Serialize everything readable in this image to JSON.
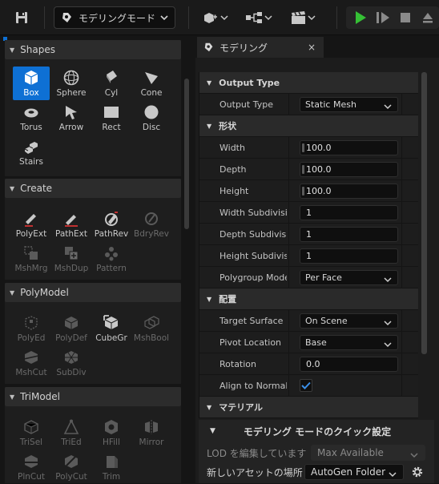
{
  "toolbar": {
    "save_icon": "save-icon",
    "mode_label": "モデリングモード"
  },
  "left_panel": {
    "sections": [
      {
        "title": "Shapes",
        "tools": [
          {
            "label": "Box",
            "icon": "box-icon",
            "selected": true
          },
          {
            "label": "Sphere",
            "icon": "sphere-icon"
          },
          {
            "label": "Cyl",
            "icon": "cylinder-icon"
          },
          {
            "label": "Cone",
            "icon": "cone-icon"
          },
          {
            "label": "Torus",
            "icon": "torus-icon"
          },
          {
            "label": "Arrow",
            "icon": "arrow-icon"
          },
          {
            "label": "Rect",
            "icon": "rect-icon"
          },
          {
            "label": "Disc",
            "icon": "disc-icon"
          },
          {
            "label": "Stairs",
            "icon": "stairs-icon"
          }
        ]
      },
      {
        "title": "Create",
        "tools": [
          {
            "label": "PolyExt",
            "icon": "polyext-icon"
          },
          {
            "label": "PathExt",
            "icon": "pathext-icon"
          },
          {
            "label": "PathRev",
            "icon": "pathrev-icon"
          },
          {
            "label": "BdryRev",
            "icon": "bdryrev-icon",
            "disabled": true
          },
          {
            "label": "MshMrg",
            "icon": "meshmerge-icon",
            "disabled": true
          },
          {
            "label": "MshDup",
            "icon": "meshdup-icon",
            "disabled": true
          },
          {
            "label": "Pattern",
            "icon": "pattern-icon",
            "disabled": true
          }
        ]
      },
      {
        "title": "PolyModel",
        "tools": [
          {
            "label": "PolyEd",
            "icon": "polyedit-icon",
            "disabled": true
          },
          {
            "label": "PolyDef",
            "icon": "polydeform-icon",
            "disabled": true
          },
          {
            "label": "CubeGr",
            "icon": "cubegrid-icon"
          },
          {
            "label": "MshBool",
            "icon": "meshboolean-icon",
            "disabled": true
          },
          {
            "label": "MshCut",
            "icon": "meshcut-icon",
            "disabled": true
          },
          {
            "label": "SubDiv",
            "icon": "subdivide-icon",
            "disabled": true
          }
        ]
      },
      {
        "title": "TriModel",
        "tools": [
          {
            "label": "TriSel",
            "icon": "triselect-icon",
            "disabled": true
          },
          {
            "label": "TriEd",
            "icon": "triedit-icon",
            "disabled": true
          },
          {
            "label": "HFill",
            "icon": "holefill-icon",
            "disabled": true
          },
          {
            "label": "Mirror",
            "icon": "mirror-icon",
            "disabled": true
          },
          {
            "label": "PlnCut",
            "icon": "planecut-icon",
            "disabled": true
          },
          {
            "label": "PolyCut",
            "icon": "polycut-icon",
            "disabled": true
          },
          {
            "label": "Trim",
            "icon": "trim-icon",
            "disabled": true
          }
        ]
      }
    ]
  },
  "panel": {
    "tab_label": "モデリング",
    "close_glyph": "×",
    "categories": {
      "output_type": "Output Type",
      "shape": "形状",
      "placement": "配置",
      "material": "マテリアル"
    },
    "rows": {
      "output_type": {
        "label": "Output Type",
        "value": "Static Mesh"
      },
      "width": {
        "label": "Width",
        "value": "100.0"
      },
      "depth": {
        "label": "Depth",
        "value": "100.0"
      },
      "height": {
        "label": "Height",
        "value": "100.0"
      },
      "width_subdiv": {
        "label": "Width Subdivisions",
        "value": "1"
      },
      "depth_subdiv": {
        "label": "Depth Subdivisions",
        "value": "1"
      },
      "height_subdiv": {
        "label": "Height Subdivisions",
        "value": "1"
      },
      "polygroup_mode": {
        "label": "Polygroup Mode",
        "value": "Per Face"
      },
      "target_surface": {
        "label": "Target Surface",
        "value": "On Scene"
      },
      "pivot_location": {
        "label": "Pivot Location",
        "value": "Base"
      },
      "rotation": {
        "label": "Rotation",
        "value": "0.0"
      },
      "align_to_normal": {
        "label": "Align to Normal",
        "checked": true
      }
    },
    "quick_settings": {
      "title": "モデリング モードのクイック設定",
      "lod_label": "LOD を編集しています",
      "lod_value": "Max Available",
      "asset_location_label": "新しいアセットの場所",
      "asset_location_value": "AutoGen Folder",
      "settings_icon": "gear-icon"
    }
  },
  "colors": {
    "accent": "#0e70d4",
    "play_green": "#35c035"
  }
}
